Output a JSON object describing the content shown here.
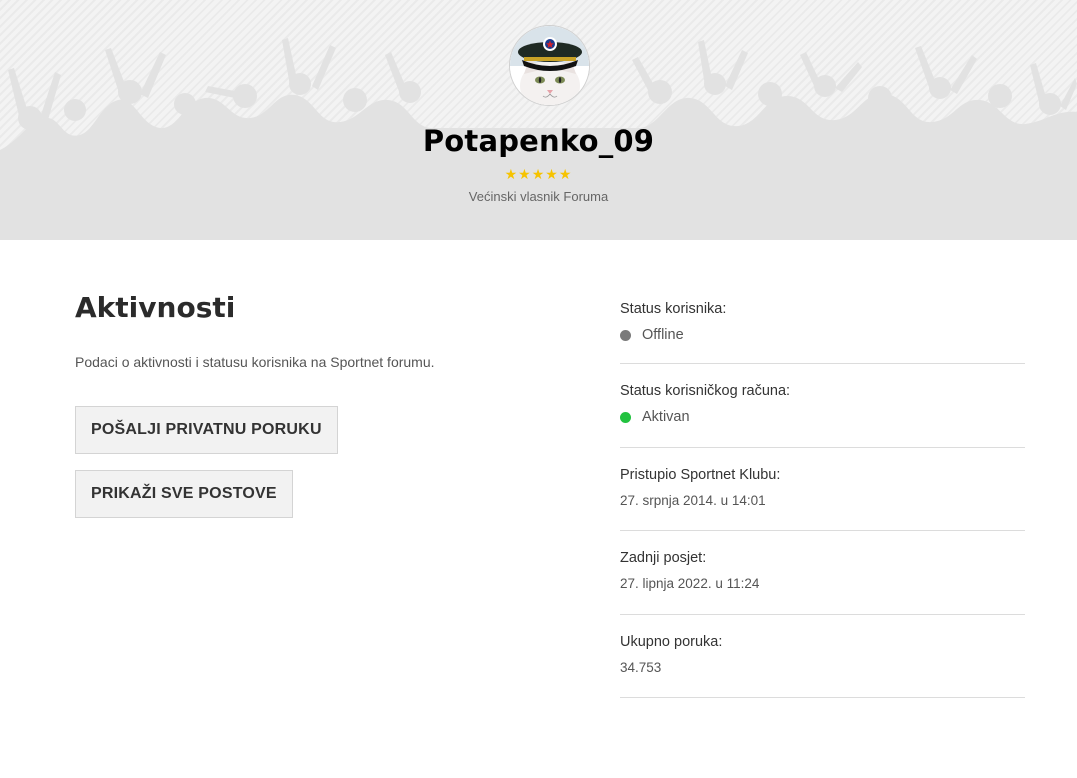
{
  "profile": {
    "username": "Potapenko_09",
    "stars": "★★★★★",
    "rank": "Većinski vlasnik Foruma"
  },
  "activity": {
    "title": "Aktivnosti",
    "description": "Podaci o aktivnosti i statusu korisnika na Sportnet forumu.",
    "send_pm_label": "POŠALJI PRIVATNU PORUKU",
    "show_posts_label": "PRIKAŽI SVE POSTOVE"
  },
  "info": {
    "user_status_label": "Status korisnika:",
    "user_status_value": "Offline",
    "account_status_label": "Status korisničkog računa:",
    "account_status_value": "Aktivan",
    "joined_label": "Pristupio Sportnet Klubu:",
    "joined_value": "27. srpnja 2014. u 14:01",
    "last_visit_label": "Zadnji posjet:",
    "last_visit_value": "27. lipnja 2022. u 11:24",
    "total_posts_label": "Ukupno poruka:",
    "total_posts_value": "34.753"
  },
  "colors": {
    "offline": "#7a7a7a",
    "active": "#22c23f",
    "stars": "#f6c300"
  }
}
